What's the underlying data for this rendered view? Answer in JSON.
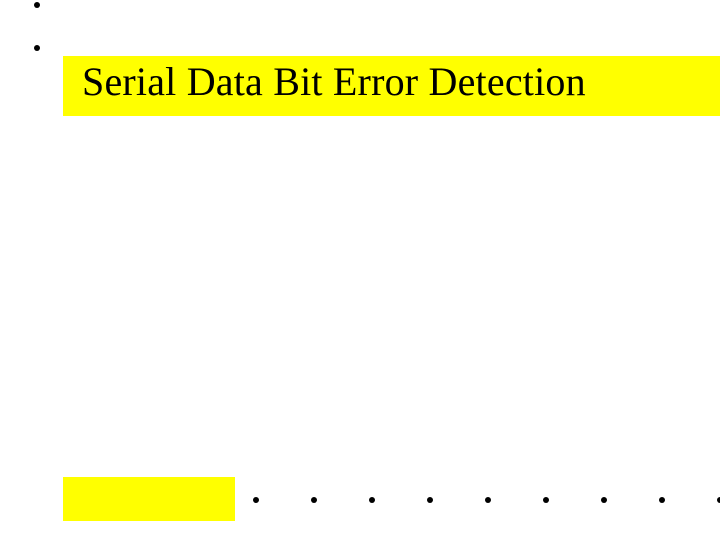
{
  "title": "Serial Data Bit Error Detection",
  "colors": {
    "highlight": "#ffff00",
    "text": "#000000",
    "background": "#ffffff"
  }
}
